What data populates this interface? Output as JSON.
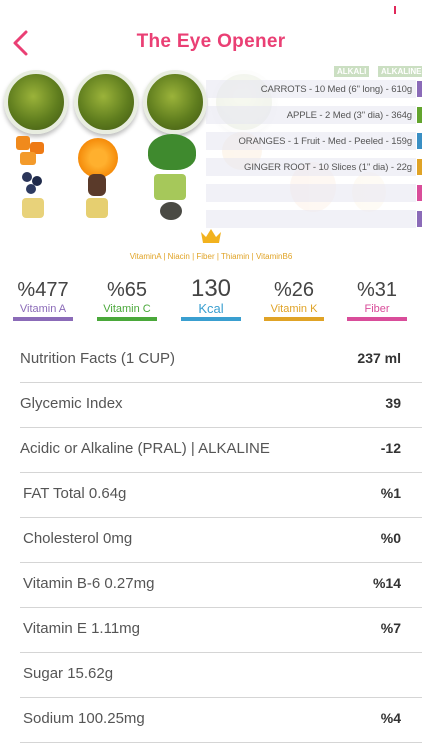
{
  "header": {
    "title": "The Eye Opener",
    "back_icon": "chevron-left-icon",
    "accent_color": "#ea3f74"
  },
  "hero": {
    "alkaline_labels": [
      "ALKALI",
      "ALKALINE"
    ],
    "ingredients": [
      {
        "text": "CARROTS - 10 Med (6'' long) - 610g",
        "color": "#8b6bb8"
      },
      {
        "text": "APPLE - 2 Med (3'' dia) - 364g",
        "color": "#63a42e"
      },
      {
        "text": "ORANGES - 1 Fruit - Med - Peeled - 159g",
        "color": "#3a8fc4"
      },
      {
        "text": "GINGER ROOT - 10 Slices (1'' dia) - 22g",
        "color": "#e0a326"
      },
      {
        "text": "",
        "color": "#d94d9a"
      },
      {
        "text": "",
        "color": "#8b6bb8"
      }
    ],
    "vitamins_line": "VitaminA | Niacin | Fiber | Thiamin | VitaminB6",
    "crown_icon": "crown-icon"
  },
  "stats": [
    {
      "value": "%477",
      "label": "Vitamin A",
      "color": "#8b6bb8"
    },
    {
      "value": "%65",
      "label": "Vitamin C",
      "color": "#4aa83a"
    },
    {
      "value": "130",
      "label": "Kcal",
      "color": "#3a9fd0"
    },
    {
      "value": "%26",
      "label": "Vitamin K",
      "color": "#e0a326"
    },
    {
      "value": "%31",
      "label": "Fiber",
      "color": "#d94d9a"
    }
  ],
  "nutrition": [
    {
      "label": "Nutrition Facts (1 CUP)",
      "value": "237 ml"
    },
    {
      "label": "Glycemic Index",
      "value": "39"
    },
    {
      "label": "Acidic or Alkaline (PRAL) | ALKALINE",
      "value": "-12"
    },
    {
      "label": "FAT Total 0.64g",
      "value": "%1"
    },
    {
      "label": "Cholesterol 0mg",
      "value": "%0"
    },
    {
      "label": "Vitamin B-6 0.27mg",
      "value": "%14"
    },
    {
      "label": "Vitamin E 1.11mg",
      "value": "%7"
    },
    {
      "label": "Sugar 15.62g",
      "value": ""
    },
    {
      "label": "Sodium 100.25mg",
      "value": "%4"
    }
  ]
}
